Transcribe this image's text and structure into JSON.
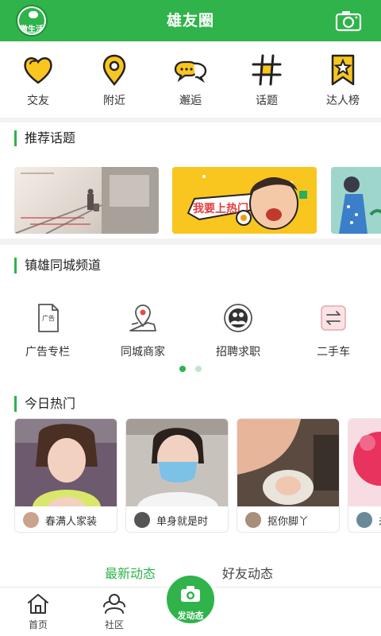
{
  "header": {
    "logo_text": "微生活",
    "title": "雄友圈"
  },
  "quick_menu": [
    {
      "label": "交友",
      "icon": "heart-icon"
    },
    {
      "label": "附近",
      "icon": "location-pin-icon"
    },
    {
      "label": "邂逅",
      "icon": "chat-bubbles-icon"
    },
    {
      "label": "话题",
      "icon": "hashtag-icon"
    },
    {
      "label": "达人榜",
      "icon": "star-ribbon-icon"
    }
  ],
  "topics": {
    "title": "推荐话题",
    "card2_text": "我要上热门"
  },
  "channel": {
    "title": "镇雄同城频道",
    "items": [
      {
        "label": "广告专栏",
        "icon": "ad-document-icon"
      },
      {
        "label": "同城商家",
        "icon": "map-location-icon"
      },
      {
        "label": "招聘求职",
        "icon": "people-icon"
      },
      {
        "label": "二手车",
        "icon": "exchange-icon"
      }
    ]
  },
  "hot": {
    "title": "今日热门",
    "items": [
      {
        "name": "春满人家装"
      },
      {
        "name": "单身就是时"
      },
      {
        "name": "抠你脚丫"
      },
      {
        "name": "未"
      }
    ]
  },
  "feed_tabs": {
    "latest": "最新动态",
    "friends": "好友动态"
  },
  "nav": {
    "home": "首页",
    "community": "社区",
    "post": "发动态"
  },
  "colors": {
    "brand_green": "#2fb34a",
    "yellow_accent": "#f9c51f"
  }
}
